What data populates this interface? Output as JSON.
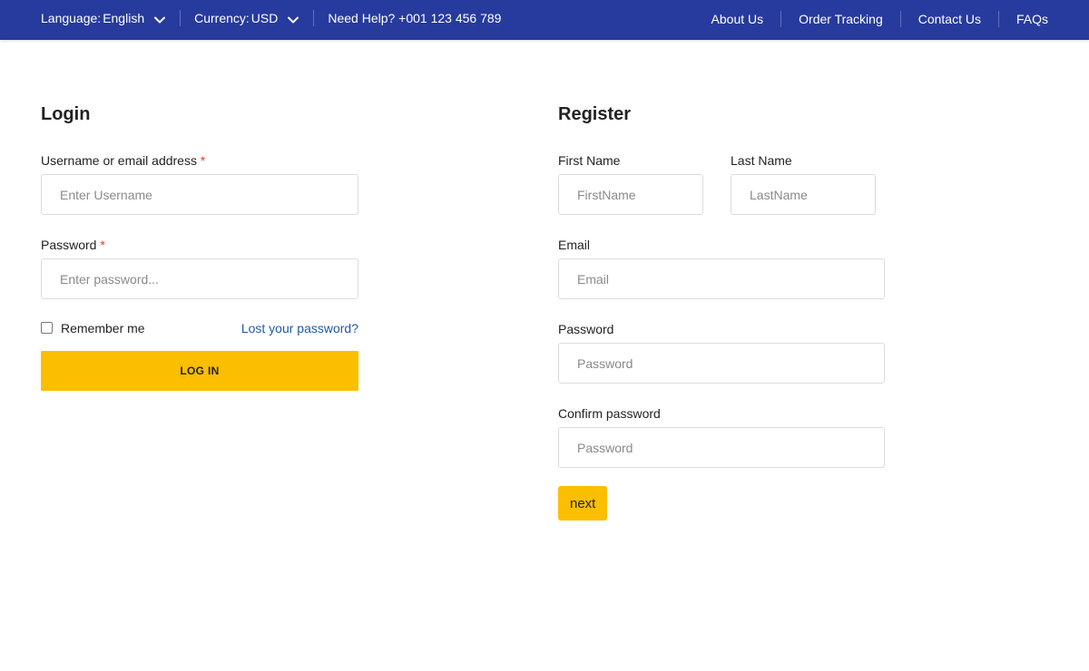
{
  "topbar": {
    "language_label": "Language:",
    "language_value": "English",
    "currency_label": "Currency:",
    "currency_value": "USD",
    "help_text": "Need Help? +001 123 456 789",
    "links": [
      "About Us",
      "Order Tracking",
      "Contact Us",
      "FAQs"
    ],
    "background_color": "#273a9d"
  },
  "login": {
    "title": "Login",
    "username_label": "Username or email address",
    "username_placeholder": "Enter Username",
    "required_mark": "*",
    "password_label": "Password",
    "password_placeholder": "Enter password...",
    "remember_label": "Remember me",
    "remember_checked": false,
    "lost_password_link": "Lost your password?",
    "submit_label": "LOG IN"
  },
  "register": {
    "title": "Register",
    "first_name_label": "First Name",
    "first_name_placeholder": "FirstName",
    "last_name_label": "Last Name",
    "last_name_placeholder": "LastName",
    "email_label": "Email",
    "email_placeholder": "Email",
    "password_label": "Password",
    "password_placeholder": "Password",
    "confirm_label": "Confirm password",
    "confirm_placeholder": "Password",
    "next_label": "next"
  },
  "colors": {
    "accent_button": "#fcbe00",
    "link": "#1f5aa6",
    "required": "#e53935"
  },
  "icons": {
    "dropdown": "chevron-down-icon"
  }
}
